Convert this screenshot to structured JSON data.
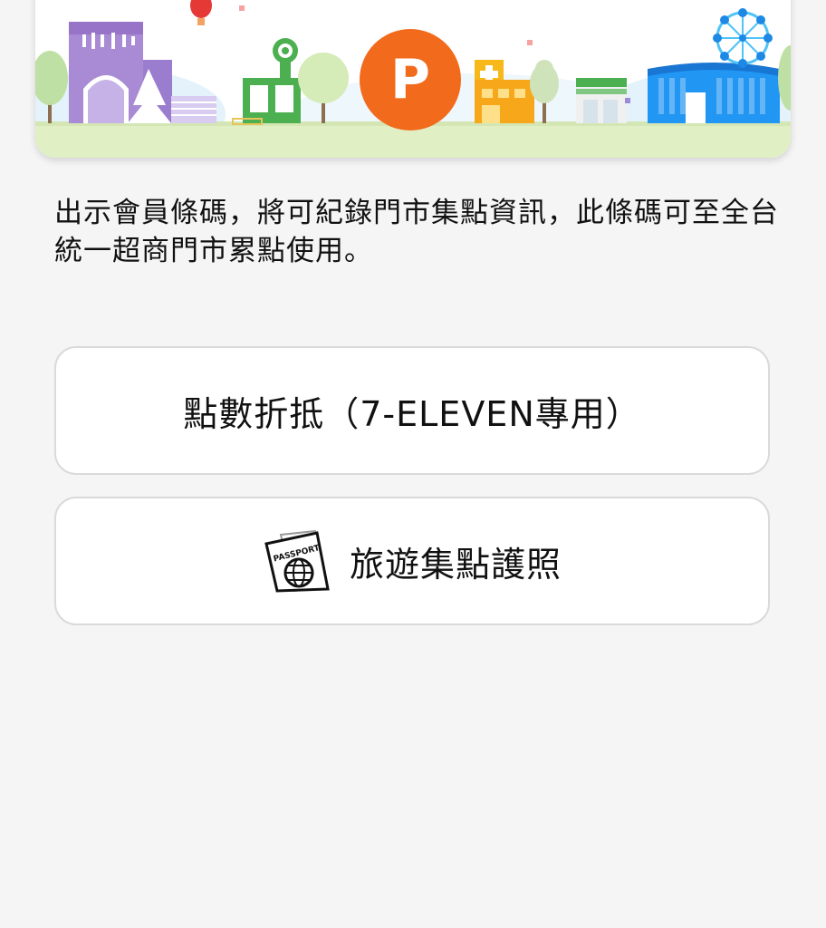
{
  "banner": {
    "logo_letter": "P",
    "logo_color": "#f26b1d"
  },
  "description": {
    "text": "出示會員條碼，將可紀錄門市集點資訊，此條碼可至全台統一超商門市累點使用。"
  },
  "buttons": [
    {
      "label": "點數折抵（7-ELEVEN專用）"
    },
    {
      "label": "旅遊集點護照",
      "icon": "passport-icon",
      "icon_text": "PASSPORT"
    }
  ]
}
